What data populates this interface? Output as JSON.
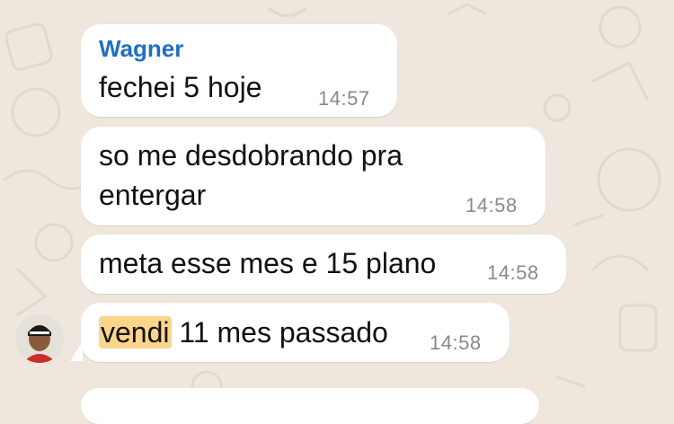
{
  "messages": [
    {
      "sender": "Wagner",
      "text": "fechei 5 hoje",
      "time": "14:57"
    },
    {
      "text_line1": "so me desdobrando pra",
      "text_line2": "entergar",
      "time": "14:58"
    },
    {
      "text": "meta esse mes e 15 plano",
      "time": "14:58"
    },
    {
      "highlight": "vendi",
      "text": " 11 mes passado",
      "time": "14:58"
    }
  ],
  "colors": {
    "background": "#efe7dd",
    "bubble": "#ffffff",
    "sender_name": "#1f6fc5",
    "highlight": "#fcd58c",
    "timestamp": "#8a8a8a"
  }
}
